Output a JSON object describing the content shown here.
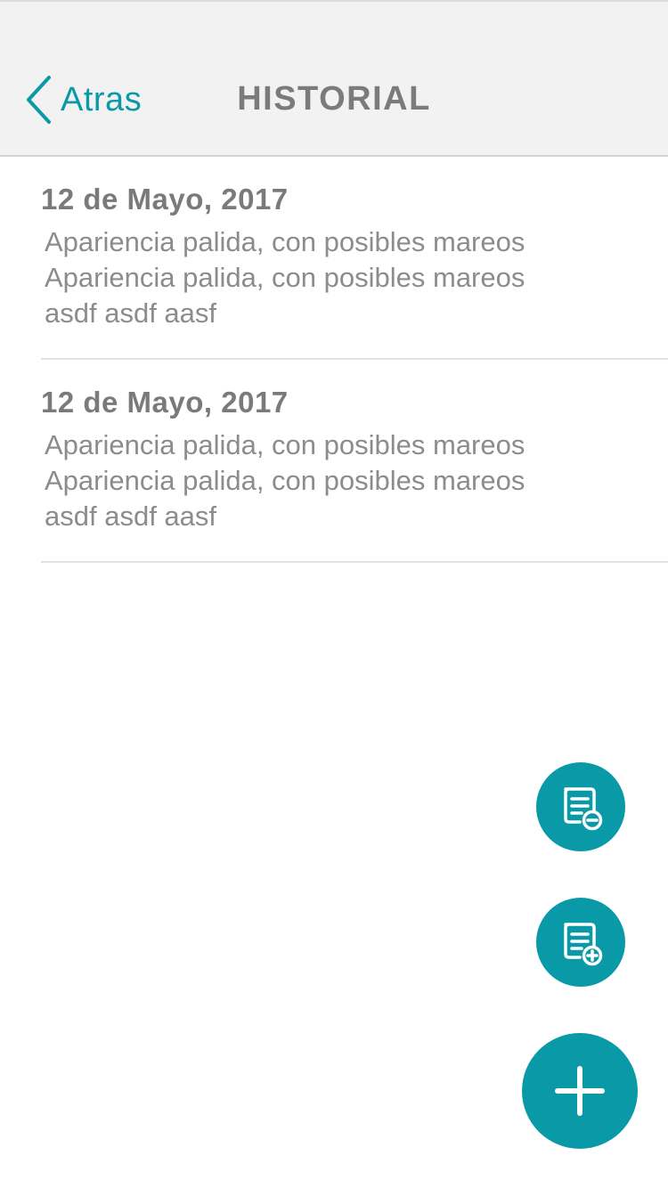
{
  "nav": {
    "back_label": "Atras",
    "title": "HISTORIAL"
  },
  "history": {
    "items": [
      {
        "date": "12 de Mayo, 2017",
        "text": "Apariencia palida, con posibles mareos\nApariencia palida, con posibles mareos\n asdf asdf aasf"
      },
      {
        "date": "12 de Mayo, 2017",
        "text": "Apariencia palida, con posibles mareos\nApariencia palida, con posibles mareos\n asdf asdf aasf"
      }
    ]
  },
  "actions": {
    "remove_note_icon": "note-minus-icon",
    "add_note_icon": "note-plus-icon",
    "add_icon": "plus-icon"
  },
  "colors": {
    "accent": "#0a9aa7",
    "nav_background": "#f2f2f2",
    "title_text": "#7b7b7b",
    "body_text": "#8c8c8c"
  }
}
